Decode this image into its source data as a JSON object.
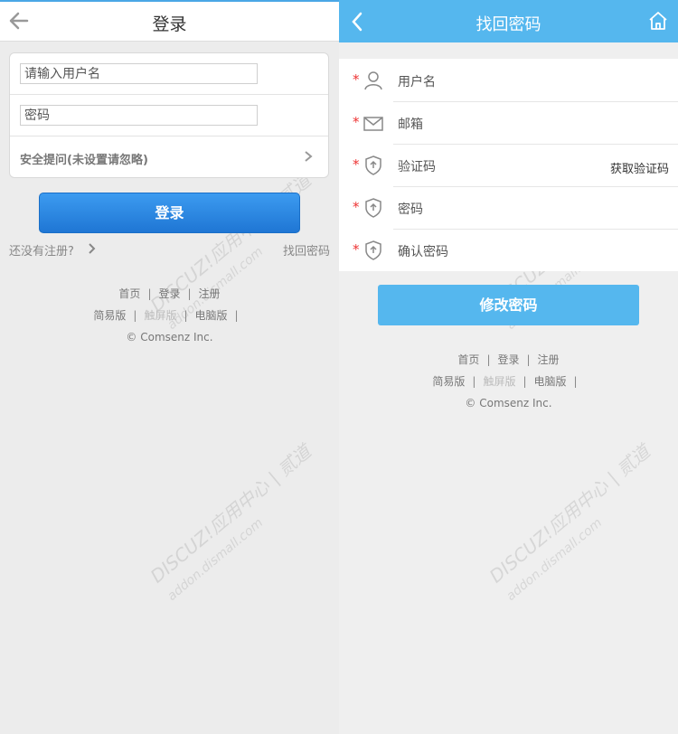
{
  "login": {
    "title": "登录",
    "username_placeholder": "请输入用户名",
    "password_placeholder": "密码",
    "security_question": "安全提问(未设置请忽略)",
    "login_button": "登录",
    "register_link": "还没有注册?",
    "find_password_link": "找回密码"
  },
  "recover": {
    "title": "找回密码",
    "fields": [
      {
        "label": "用户名",
        "icon": "user-icon",
        "required": true
      },
      {
        "label": "邮箱",
        "icon": "mail-icon",
        "required": true
      },
      {
        "label": "验证码",
        "icon": "shield-icon",
        "required": true
      },
      {
        "label": "密码",
        "icon": "shield-icon",
        "required": true
      },
      {
        "label": "确认密码",
        "icon": "shield-icon",
        "required": true
      }
    ],
    "required_mark": "*",
    "get_code": "获取验证码",
    "submit_button": "修改密码"
  },
  "footer": {
    "home": "首页",
    "login": "登录",
    "register": "注册",
    "simple": "简易版",
    "touch": "触屏版",
    "pc": "电脑版",
    "sep": "|",
    "copyright": "© Comsenz Inc."
  },
  "watermark": {
    "brand": "DISCUZ!应用中心 | 贰道",
    "site": "addon.dismall.com"
  },
  "colors": {
    "header_blue": "#55b7ee",
    "login_button": "#2a87e0",
    "required_star": "#e33333"
  }
}
